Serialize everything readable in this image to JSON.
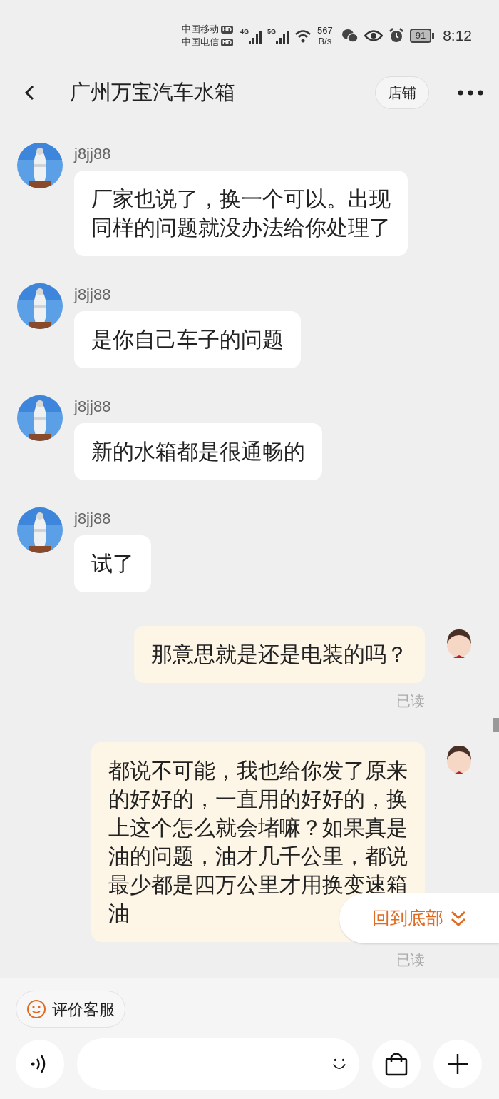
{
  "status_bar": {
    "carriers": [
      {
        "name": "中国移动",
        "badge": "HD"
      },
      {
        "name": "中国电信",
        "badge": "HD"
      }
    ],
    "networks": [
      "4G",
      "5G"
    ],
    "speed_value": "567",
    "speed_unit": "B/s",
    "battery": "91",
    "time": "8:12"
  },
  "header": {
    "title": "广州万宝汽车水箱",
    "shop_button": "店铺"
  },
  "messages": [
    {
      "kind": "incoming",
      "sender": "j8jj88",
      "text": "厂家也说了，换一个可以。出现同样的问题就没办法给你处理了"
    },
    {
      "kind": "incoming",
      "sender": "j8jj88",
      "text": "是你自己车子的问题"
    },
    {
      "kind": "incoming",
      "sender": "j8jj88",
      "text": "新的水箱都是很通畅的"
    },
    {
      "kind": "incoming",
      "sender": "j8jj88",
      "text": "试了"
    },
    {
      "kind": "outgoing",
      "text": "那意思就是还是电装的吗？",
      "receipt": "已读"
    },
    {
      "kind": "outgoing",
      "text": "都说不可能，我也给你发了原来的好好的，一直用的好好的，换上这个怎么就会堵嘛？如果真是油的问题，油才几千公里，都说最少都是四万公里才用换变速箱油",
      "receipt": "已读"
    }
  ],
  "back_to_bottom": "回到底部",
  "rate_button": "评价客服"
}
